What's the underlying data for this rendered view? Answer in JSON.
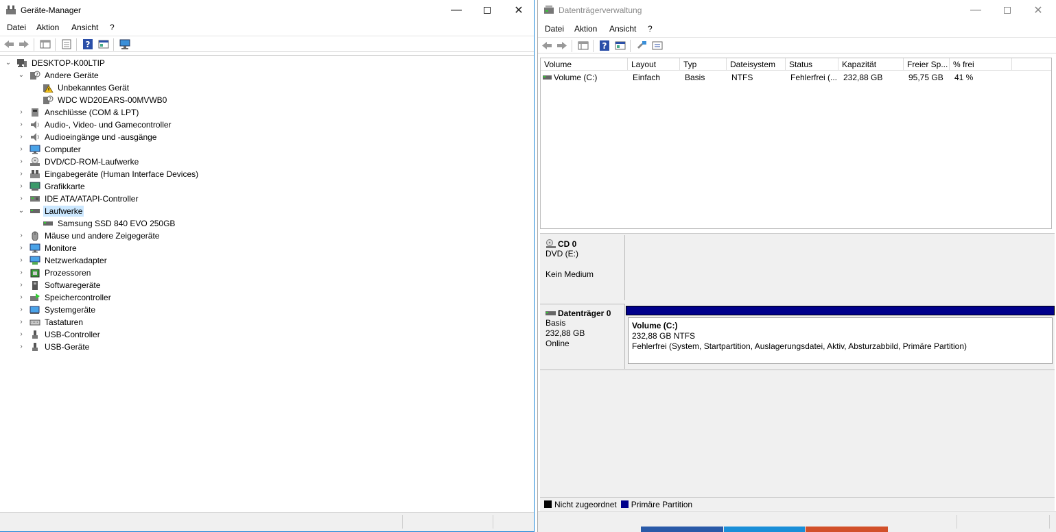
{
  "device_manager": {
    "title": "Geräte-Manager",
    "menu": [
      "Datei",
      "Aktion",
      "Ansicht",
      "?"
    ],
    "tree": {
      "root": "DESKTOP-K00LTIP",
      "categories": [
        {
          "label": "Andere Geräte",
          "expanded": true,
          "icon": "unknown-device-icon",
          "children": [
            {
              "label": "Unbekanntes Gerät",
              "icon": "warning-device-icon"
            },
            {
              "label": "WDC WD20EARS-00MVWB0",
              "icon": "unknown-device-icon"
            }
          ]
        },
        {
          "label": "Anschlüsse (COM & LPT)",
          "icon": "port-icon"
        },
        {
          "label": "Audio-, Video- und Gamecontroller",
          "icon": "speaker-icon"
        },
        {
          "label": "Audioeingänge und -ausgänge",
          "icon": "speaker-icon"
        },
        {
          "label": "Computer",
          "icon": "monitor-icon"
        },
        {
          "label": "DVD/CD-ROM-Laufwerke",
          "icon": "dvd-drive-icon"
        },
        {
          "label": "Eingabegeräte (Human Interface Devices)",
          "icon": "hid-icon"
        },
        {
          "label": "Grafikkarte",
          "icon": "display-adapter-icon"
        },
        {
          "label": "IDE ATA/ATAPI-Controller",
          "icon": "ide-controller-icon"
        },
        {
          "label": "Laufwerke",
          "expanded": true,
          "selected": true,
          "icon": "disk-drive-icon",
          "children": [
            {
              "label": "Samsung SSD 840 EVO 250GB",
              "icon": "disk-drive-icon"
            }
          ]
        },
        {
          "label": "Mäuse und andere Zeigegeräte",
          "icon": "mouse-icon"
        },
        {
          "label": "Monitore",
          "icon": "monitor-icon"
        },
        {
          "label": "Netzwerkadapter",
          "icon": "network-adapter-icon"
        },
        {
          "label": "Prozessoren",
          "icon": "processor-icon"
        },
        {
          "label": "Softwaregeräte",
          "icon": "software-device-icon"
        },
        {
          "label": "Speichercontroller",
          "icon": "storage-controller-icon"
        },
        {
          "label": "Systemgeräte",
          "icon": "system-device-icon"
        },
        {
          "label": "Tastaturen",
          "icon": "keyboard-icon"
        },
        {
          "label": "USB-Controller",
          "icon": "usb-icon"
        },
        {
          "label": "USB-Geräte",
          "icon": "usb-icon"
        }
      ]
    }
  },
  "disk_management": {
    "title": "Datenträgerverwaltung",
    "menu": [
      "Datei",
      "Aktion",
      "Ansicht",
      "?"
    ],
    "columns": [
      "Volume",
      "Layout",
      "Typ",
      "Dateisystem",
      "Status",
      "Kapazität",
      "Freier Sp...",
      "% frei"
    ],
    "rows": [
      [
        "Volume (C:)",
        "Einfach",
        "Basis",
        "NTFS",
        "Fehlerfrei (...",
        "232,88 GB",
        "95,75 GB",
        "41 %"
      ]
    ],
    "disks": [
      {
        "name": "CD 0",
        "lines": [
          "DVD (E:)",
          "",
          "Kein Medium"
        ]
      },
      {
        "name": "Datenträger 0",
        "lines": [
          "Basis",
          "232,88 GB",
          "Online"
        ],
        "partition": {
          "name": "Volume  (C:)",
          "size": "232,88 GB NTFS",
          "status": "Fehlerfrei (System, Startpartition, Auslagerungsdatei, Aktiv, Absturzabbild, Primäre Partition)"
        }
      }
    ],
    "legend": [
      {
        "label": "Nicht zugeordnet",
        "color": "#000000"
      },
      {
        "label": "Primäre Partition",
        "color": "#00008b"
      }
    ]
  },
  "colors": {
    "accent": "#1883d7",
    "selection": "#cce8ff",
    "primary_partition": "#00008b"
  }
}
